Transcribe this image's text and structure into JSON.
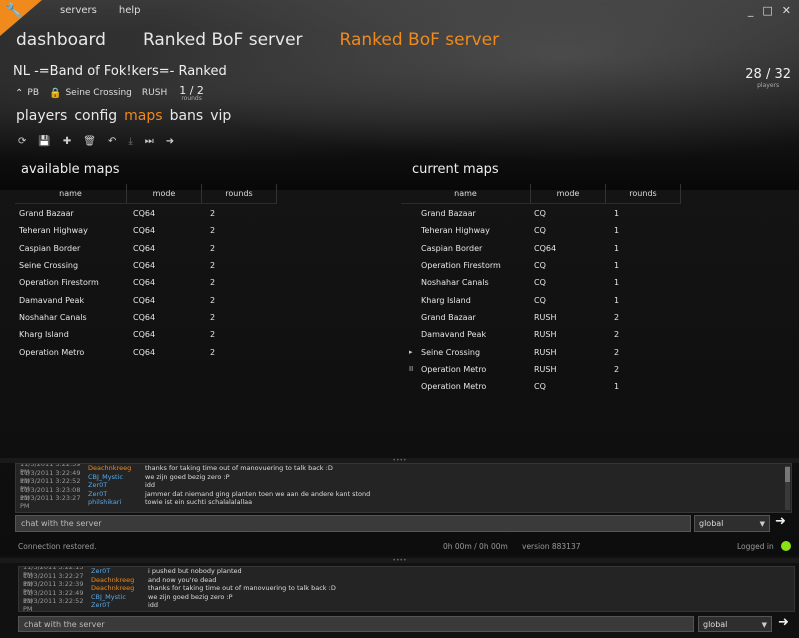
{
  "app": {
    "corner_icon": "wrench-icon",
    "menu": [
      "servers",
      "help"
    ],
    "window_controls": [
      "_",
      "□",
      "✕"
    ]
  },
  "page_tabs": [
    "dashboard",
    "Ranked BoF server",
    "Ranked BoF server"
  ],
  "server": {
    "name": "NL -=Band of Fok!kers=- Ranked",
    "pb_label": "PB",
    "map": "Seine Crossing",
    "mode": "RUSH",
    "rounds_value": "1 / 2",
    "rounds_label": "rounds",
    "players_value": "28 / 32",
    "players_label": "players"
  },
  "subtabs": [
    "players",
    "config",
    "maps",
    "bans",
    "vip"
  ],
  "toolbar_icons": [
    "refresh-icon",
    "save-icon",
    "add-icon",
    "delete-icon",
    "undo-icon",
    "download-icon",
    "skip-icon",
    "arrow-right-icon"
  ],
  "available_maps": {
    "title": "available maps",
    "columns": [
      "name",
      "mode",
      "rounds"
    ],
    "rows": [
      [
        "Grand Bazaar",
        "CQ64",
        "2"
      ],
      [
        "Teheran Highway",
        "CQ64",
        "2"
      ],
      [
        "Caspian Border",
        "CQ64",
        "2"
      ],
      [
        "Seine Crossing",
        "CQ64",
        "2"
      ],
      [
        "Operation Firestorm",
        "CQ64",
        "2"
      ],
      [
        "Damavand Peak",
        "CQ64",
        "2"
      ],
      [
        "Noshahar Canals",
        "CQ64",
        "2"
      ],
      [
        "Kharg Island",
        "CQ64",
        "2"
      ],
      [
        "Operation Metro",
        "CQ64",
        "2"
      ]
    ]
  },
  "current_maps": {
    "title": "current maps",
    "columns": [
      "name",
      "mode",
      "rounds"
    ],
    "rows": [
      [
        "",
        "Grand Bazaar",
        "CQ",
        "1"
      ],
      [
        "",
        "Teheran Highway",
        "CQ",
        "1"
      ],
      [
        "",
        "Caspian Border",
        "CQ64",
        "1"
      ],
      [
        "",
        "Operation Firestorm",
        "CQ",
        "1"
      ],
      [
        "",
        "Noshahar Canals",
        "CQ",
        "1"
      ],
      [
        "",
        "Kharg Island",
        "CQ",
        "1"
      ],
      [
        "",
        "Grand Bazaar",
        "RUSH",
        "2"
      ],
      [
        "",
        "Damavand Peak",
        "RUSH",
        "2"
      ],
      [
        "▸",
        "Seine Crossing",
        "RUSH",
        "2"
      ],
      [
        "II",
        "Operation Metro",
        "RUSH",
        "2"
      ],
      [
        "",
        "Operation Metro",
        "CQ",
        "1"
      ]
    ]
  },
  "chat_upper": [
    [
      "11/3/2011 3:22:39 PM",
      "Deachnkreeg",
      "thanks for taking time out of manovuering to talk back :D",
      "#f08a1c"
    ],
    [
      "11/3/2011 3:22:49 PM",
      "CBJ_Mystic",
      "we zijn goed bezig zero :P",
      "#5aa8e6"
    ],
    [
      "11/3/2011 3:22:52 PM",
      "Zer0T",
      "idd",
      "#5aa8e6"
    ],
    [
      "11/3/2011 3:23:08 PM",
      "Zer0T",
      "jammer dat niemand ging planten toen we aan de andere kant stond",
      "#5aa8e6"
    ],
    [
      "11/3/2011 3:23:27 PM",
      "philshikari",
      "towie ist ein suchti schalalalallaa",
      "#5aa8e6"
    ]
  ],
  "chat_lower": [
    [
      "11/3/2011 3:22:15 PM",
      "Zer0T",
      "i pushed but nobody planted",
      "#5aa8e6"
    ],
    [
      "11/3/2011 3:22:27 PM",
      "Deachnkreeg",
      "and now you're dead",
      "#f08a1c"
    ],
    [
      "11/3/2011 3:22:39 PM",
      "Deachnkreeg",
      "thanks for taking time out of manovuering to talk back :D",
      "#f08a1c"
    ],
    [
      "11/3/2011 3:22:49 PM",
      "CBJ_Mystic",
      "we zijn goed bezig zero :P",
      "#5aa8e6"
    ],
    [
      "11/3/2011 3:22:52 PM",
      "Zer0T",
      "idd",
      "#5aa8e6"
    ]
  ],
  "chat_input_placeholder": "chat with the server",
  "chat_scope": "global",
  "status": {
    "message": "Connection restored.",
    "timing": "0h 00m  /  0h 00m",
    "version": "version  883137",
    "login": "Logged in"
  },
  "colors": {
    "accent": "#f08a1c",
    "player_name": "#5aa8e6",
    "online": "#8be013"
  }
}
